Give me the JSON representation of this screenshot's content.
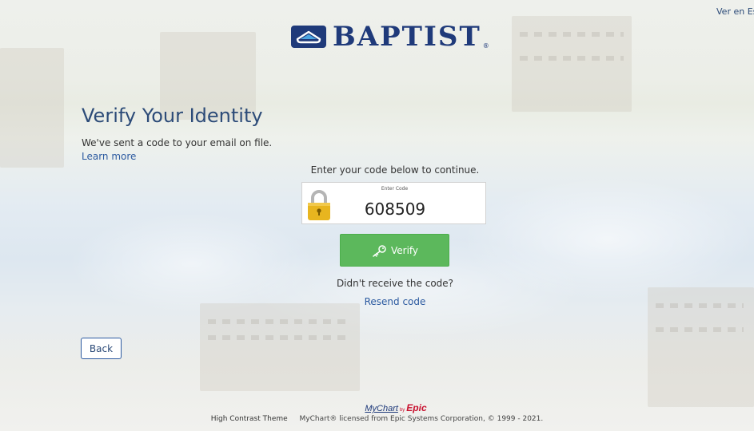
{
  "header": {
    "language_link": "Ver en Español",
    "brand_name": "BAPTIST",
    "brand_reg": "®"
  },
  "main": {
    "title": "Verify Your Identity",
    "subtitle": "We've sent a code to your email on file.",
    "learn_more": "Learn more",
    "instruction": "Enter your code below to continue.",
    "code_label": "Enter Code",
    "code_value": "608509",
    "verify_label": "Verify",
    "didnt_receive": "Didn't receive the code?",
    "resend_label": "Resend code",
    "back_label": "Back"
  },
  "footer": {
    "mychart": "MyChart",
    "by": "by",
    "epic": "Epic",
    "high_contrast": "High Contrast Theme",
    "copyright": "MyChart® licensed from Epic Systems Corporation, © 1999 - 2021."
  },
  "colors": {
    "brand_blue": "#1f3a7a",
    "link_blue": "#2c5aa0",
    "verify_green": "#5cb85c",
    "lock_gold": "#e8b51f",
    "epic_red": "#c8102e"
  },
  "icons": {
    "logo": "baptist-logo-icon",
    "lock": "lock-icon",
    "key": "key-icon"
  }
}
